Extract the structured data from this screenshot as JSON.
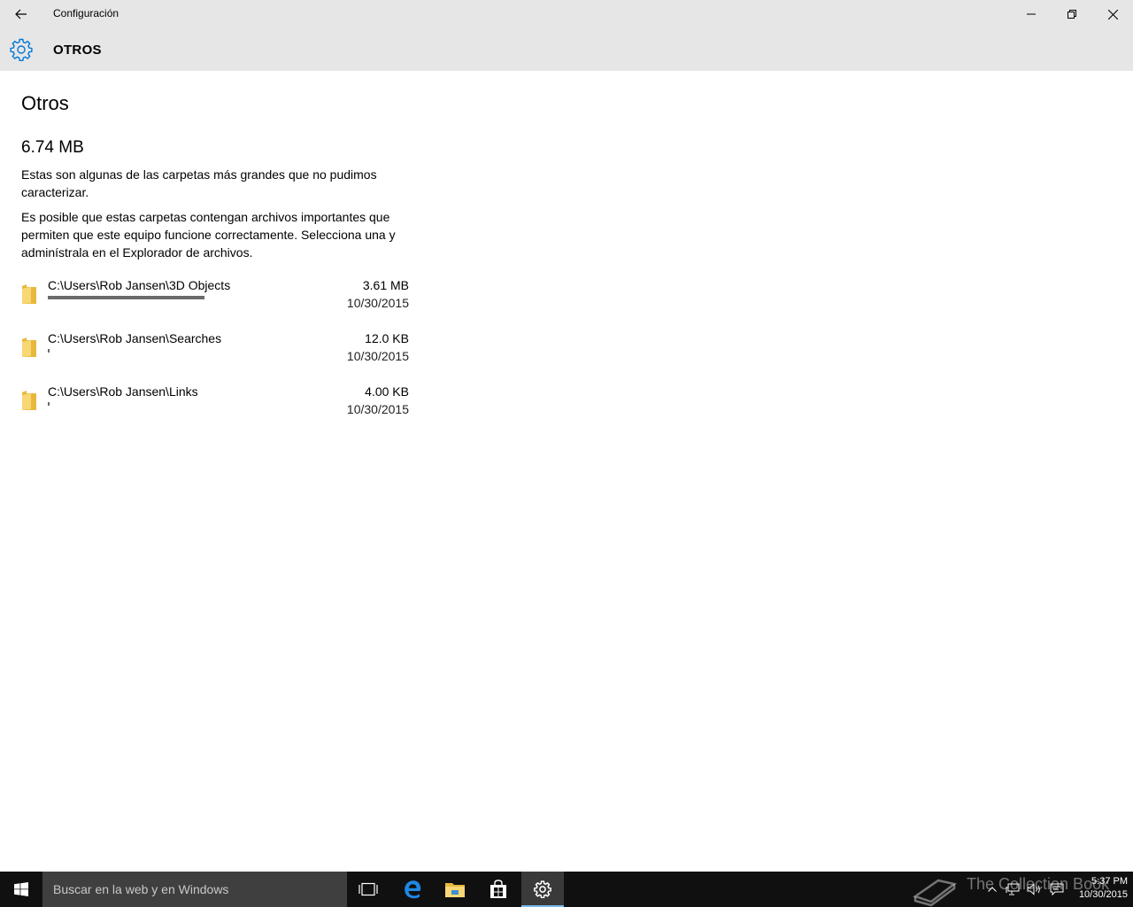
{
  "window": {
    "app_title": "Configuración"
  },
  "header": {
    "section_title": "OTROS",
    "icon": "gear-icon"
  },
  "main": {
    "page_title": "Otros",
    "total_size": "6.74 MB",
    "description_1": "Estas son algunas de las carpetas más grandes que no pudimos caracterizar.",
    "description_2": "Es posible que estas carpetas contengan archivos importantes que permiten que este equipo funcione correctamente. Selecciona una y adminístrala en el Explorador de archivos.",
    "folders": [
      {
        "path": "C:\\Users\\Rob Jansen\\3D Objects",
        "size": "3.61 MB",
        "date": "10/30/2015",
        "usage_fraction": 0.535
      },
      {
        "path": "C:\\Users\\Rob Jansen\\Searches",
        "size": "12.0 KB",
        "date": "10/30/2015",
        "usage_fraction": 0.002
      },
      {
        "path": "C:\\Users\\Rob Jansen\\Links",
        "size": "4.00 KB",
        "date": "10/30/2015",
        "usage_fraction": 0.001
      }
    ]
  },
  "taskbar": {
    "search_placeholder": "Buscar en la web y en Windows",
    "apps": [
      "task-view-icon",
      "edge-icon",
      "file-explorer-icon",
      "store-icon",
      "settings-icon"
    ],
    "active_app": "settings-icon",
    "accent_color": "#76b9ed",
    "watermark_text": "The Collection Book",
    "clock_time": "5:37 PM",
    "clock_date": "10/30/2015"
  },
  "colors": {
    "titlebar_bg": "#e6e6e6",
    "accent": "#0078d7",
    "folder_yellow": "#f3cd5a",
    "usage_bar": "#6b6b6b",
    "taskbar_bg": "#101010"
  }
}
